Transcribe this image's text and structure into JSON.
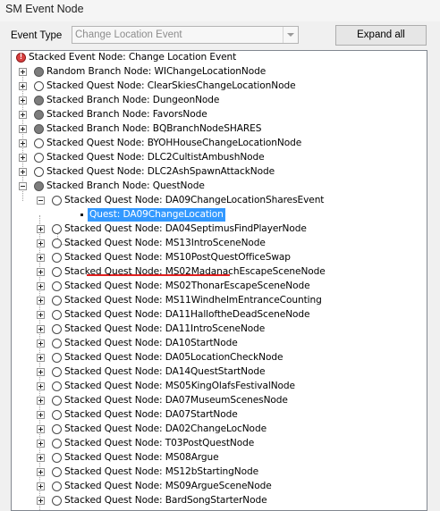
{
  "window": {
    "title": "SM Event Node"
  },
  "toolbar": {
    "event_type_label": "Event Type",
    "event_type_value": "Change Location Event",
    "expand_all_label": "Expand all"
  },
  "tree": {
    "nodes": [
      {
        "label": "Stacked Event Node: Change Location Event",
        "level": 0,
        "expander": "none",
        "icon": "root"
      },
      {
        "label": "Random Branch Node: WIChangeLocationNode",
        "level": 1,
        "expander": "plus",
        "icon": "gray"
      },
      {
        "label": "Stacked Quest Node: ClearSkiesChangeLocationNode",
        "level": 1,
        "expander": "plus",
        "icon": "white"
      },
      {
        "label": "Stacked Branch Node: DungeonNode",
        "level": 1,
        "expander": "plus",
        "icon": "gray"
      },
      {
        "label": "Stacked Branch Node: FavorsNode",
        "level": 1,
        "expander": "plus",
        "icon": "gray"
      },
      {
        "label": "Stacked Branch Node: BQBranchNodeSHARES",
        "level": 1,
        "expander": "plus",
        "icon": "gray"
      },
      {
        "label": "Stacked Quest Node: BYOHHouseChangeLocationNode",
        "level": 1,
        "expander": "plus",
        "icon": "white"
      },
      {
        "label": "Stacked Quest Node: DLC2CultistAmbushNode",
        "level": 1,
        "expander": "plus",
        "icon": "white"
      },
      {
        "label": "Stacked Quest Node: DLC2AshSpawnAttackNode",
        "level": 1,
        "expander": "plus",
        "icon": "white"
      },
      {
        "label": "Stacked Branch Node: QuestNode",
        "level": 1,
        "expander": "minus",
        "icon": "gray"
      },
      {
        "label": "Stacked Quest Node: DA09ChangeLocationSharesEvent",
        "level": 2,
        "expander": "minus",
        "icon": "white"
      },
      {
        "label": "Quest: DA09ChangeLocation",
        "level": 3,
        "expander": "none",
        "icon": "square",
        "selected": true
      },
      {
        "label": "Stacked Quest Node: DA04SeptimusFindPlayerNode",
        "level": 2,
        "expander": "plus",
        "icon": "white"
      },
      {
        "label": "Stacked Quest Node: MS13IntroSceneNode",
        "level": 2,
        "expander": "plus",
        "icon": "white"
      },
      {
        "label": "Stacked Quest Node: MS10PostQuestOfficeSwap",
        "level": 2,
        "expander": "plus",
        "icon": "white"
      },
      {
        "label": "Stacked Quest Node: MS02MadanachEscapeSceneNode",
        "level": 2,
        "expander": "plus",
        "icon": "white"
      },
      {
        "label": "Stacked Quest Node: MS02ThonarEscapeSceneNode",
        "level": 2,
        "expander": "plus",
        "icon": "white"
      },
      {
        "label": "Stacked Quest Node: MS11WindhelmEntranceCounting",
        "level": 2,
        "expander": "plus",
        "icon": "white"
      },
      {
        "label": "Stacked Quest Node: DA11HalloftheDeadSceneNode",
        "level": 2,
        "expander": "plus",
        "icon": "white"
      },
      {
        "label": "Stacked Quest Node: DA11IntroSceneNode",
        "level": 2,
        "expander": "plus",
        "icon": "white"
      },
      {
        "label": "Stacked Quest Node: DA10StartNode",
        "level": 2,
        "expander": "plus",
        "icon": "white"
      },
      {
        "label": "Stacked Quest Node: DA05LocationCheckNode",
        "level": 2,
        "expander": "plus",
        "icon": "white"
      },
      {
        "label": "Stacked Quest Node: DA14QuestStartNode",
        "level": 2,
        "expander": "plus",
        "icon": "white"
      },
      {
        "label": "Stacked Quest Node: MS05KingOlafsFestivalNode",
        "level": 2,
        "expander": "plus",
        "icon": "white"
      },
      {
        "label": "Stacked Quest Node: DA07MuseumScenesNode",
        "level": 2,
        "expander": "plus",
        "icon": "white"
      },
      {
        "label": "Stacked Quest Node: DA07StartNode",
        "level": 2,
        "expander": "plus",
        "icon": "white"
      },
      {
        "label": "Stacked Quest Node: DA02ChangeLocNode",
        "level": 2,
        "expander": "plus",
        "icon": "white"
      },
      {
        "label": "Stacked Quest Node: T03PostQuestNode",
        "level": 2,
        "expander": "plus",
        "icon": "white"
      },
      {
        "label": "Stacked Quest Node: MS08Argue",
        "level": 2,
        "expander": "plus",
        "icon": "white"
      },
      {
        "label": "Stacked Quest Node: MS12bStartingNode",
        "level": 2,
        "expander": "plus",
        "icon": "white"
      },
      {
        "label": "Stacked Quest Node: MS09ArgueSceneNode",
        "level": 2,
        "expander": "plus",
        "icon": "white"
      },
      {
        "label": "Stacked Quest Node: BardSongStarterNode",
        "level": 2,
        "expander": "plus",
        "icon": "white"
      }
    ]
  }
}
